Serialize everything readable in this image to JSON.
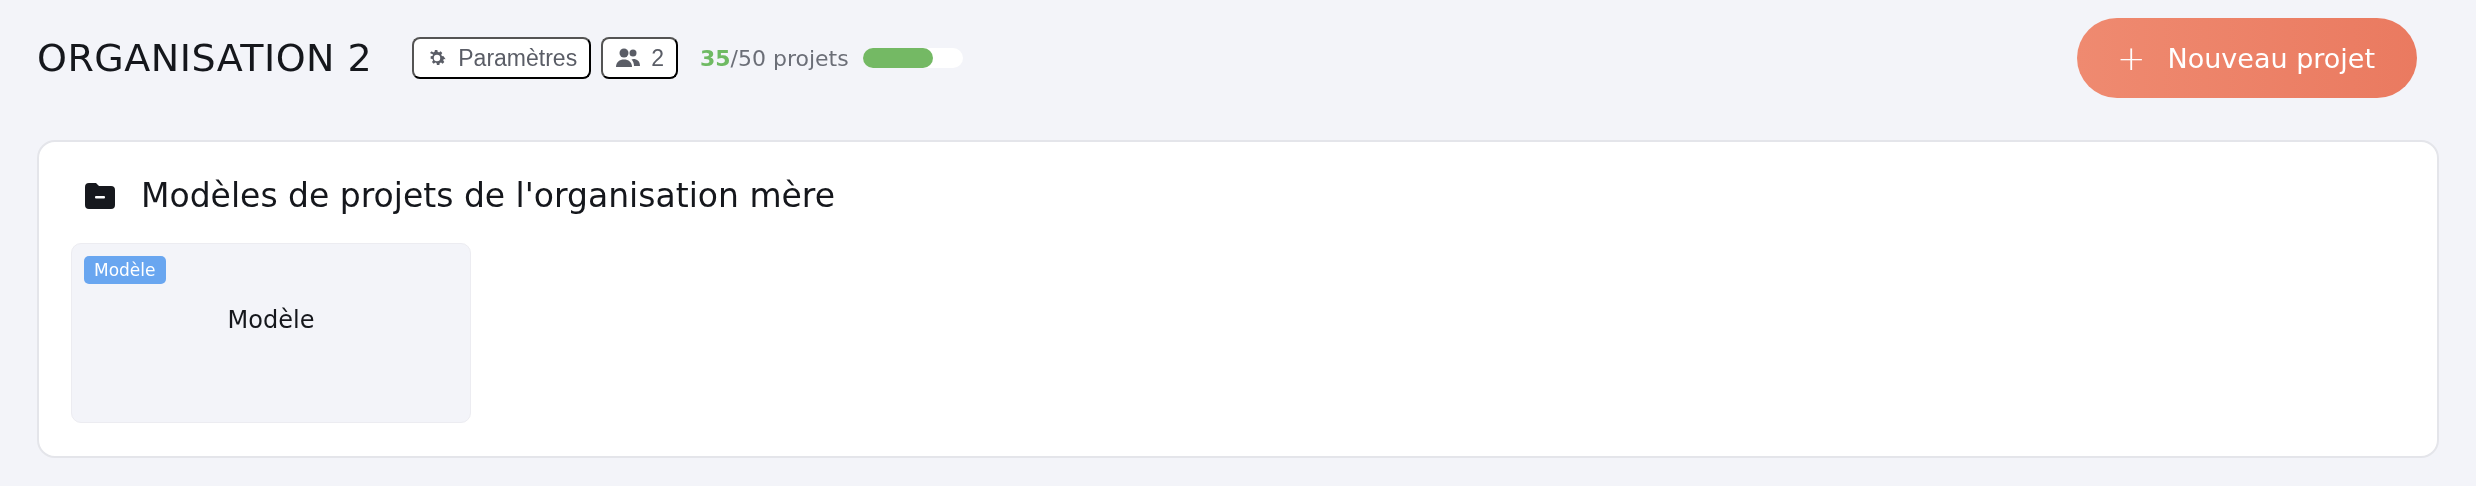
{
  "header": {
    "title": "ORGANISATION 2",
    "settings_label": "Paramètres",
    "members_count": "2",
    "projects_used": "35",
    "projects_total": "/50 projets",
    "quota": {
      "level": 0.7
    },
    "new_button": "Nouveau projet",
    "new_icon": "+"
  },
  "section": {
    "title": "Modèles de projets de l'organisation mère",
    "templates": [
      {
        "badge": "Modèle",
        "name": "Modèle"
      }
    ]
  }
}
